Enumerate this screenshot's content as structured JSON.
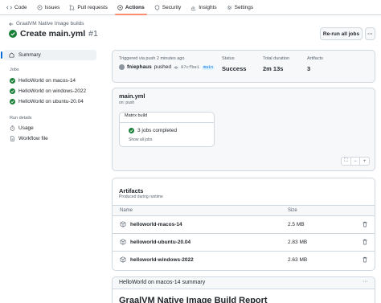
{
  "nav": {
    "tabs": [
      {
        "label": "Code",
        "icon": "code-icon"
      },
      {
        "label": "Issues",
        "icon": "issue-icon"
      },
      {
        "label": "Pull requests",
        "icon": "pull-request-icon"
      },
      {
        "label": "Actions",
        "icon": "play-icon",
        "selected": true
      },
      {
        "label": "Security",
        "icon": "shield-icon"
      },
      {
        "label": "Insights",
        "icon": "graph-icon"
      },
      {
        "label": "Settings",
        "icon": "gear-icon"
      }
    ]
  },
  "header": {
    "back_link": "GraalVM Native Image builds",
    "title": "Create main.yml",
    "run_number": "#1",
    "rerun_label": "Re-run all jobs",
    "more_label": "···"
  },
  "sidebar": {
    "summary_label": "Summary",
    "jobs_heading": "Jobs",
    "jobs": [
      "HelloWorld on macos-14",
      "HelloWorld on windows-2022",
      "HelloWorld on ubuntu-20.04"
    ],
    "run_details_heading": "Run details",
    "details": [
      {
        "label": "Usage",
        "icon": "stopwatch-icon"
      },
      {
        "label": "Workflow file",
        "icon": "file-icon"
      }
    ]
  },
  "summary": {
    "trigger_label": "Triggered via push 2 minutes ago",
    "user": "fniephaus",
    "action": "pushed",
    "commit_sha": "97cfbe1",
    "branch": "main",
    "status_label": "Status",
    "status_value": "Success",
    "duration_label": "Total duration",
    "duration_value": "2m 13s",
    "artifacts_label": "Artifacts",
    "artifacts_value": "3"
  },
  "workflow": {
    "file": "main.yml",
    "trigger": "on: push",
    "matrix_label": "Matrix build",
    "jobs_completed": "3 jobs completed",
    "show_all": "Show all jobs",
    "zoom_controls": [
      "⛶",
      "−",
      "+"
    ]
  },
  "artifacts": {
    "title": "Artifacts",
    "subtitle": "Produced during runtime",
    "columns": [
      "Name",
      "Size"
    ],
    "rows": [
      {
        "name": "helloworld-macos-14",
        "size": "2.5 MB"
      },
      {
        "name": "helloworld-ubuntu-20.04",
        "size": "2.83 MB"
      },
      {
        "name": "helloworld-windows-2022",
        "size": "2.63 MB"
      }
    ]
  },
  "step_summary": {
    "heading": "HelloWorld on macos-14 summary",
    "dots": "···",
    "report_title": "GraalVM Native Image Build Report"
  },
  "colors": {
    "success": "#1a7f37",
    "accent": "#0969da",
    "tab_underline": "#fd8c73",
    "border": "#d0d7de",
    "muted_bg": "#f6f8fa"
  }
}
